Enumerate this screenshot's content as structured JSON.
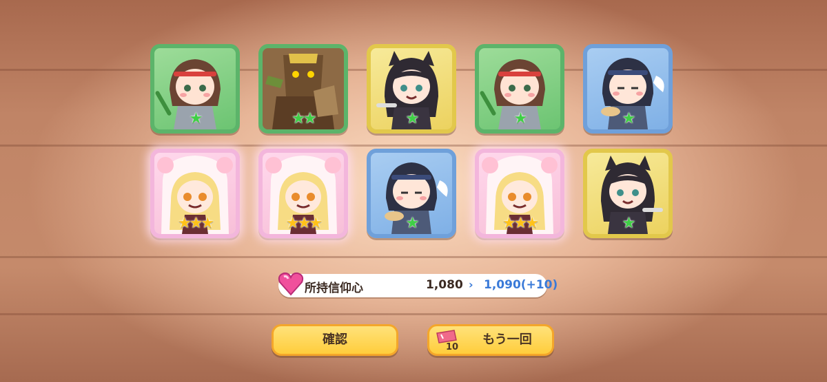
{
  "cards": [
    {
      "id": "c1",
      "frame": "green",
      "stars": 1,
      "star_color": "green",
      "character": "headband-girl"
    },
    {
      "id": "c2",
      "frame": "green",
      "stars": 2,
      "star_color": "green",
      "character": "wood-golem"
    },
    {
      "id": "c3",
      "frame": "yellow",
      "stars": 1,
      "star_color": "green",
      "character": "wolf-girl"
    },
    {
      "id": "c4",
      "frame": "green",
      "stars": 1,
      "star_color": "green",
      "character": "headband-girl"
    },
    {
      "id": "c5",
      "frame": "blue",
      "stars": 1,
      "star_color": "green",
      "character": "ninja-girl"
    },
    {
      "id": "c6",
      "frame": "rainbow",
      "stars": 3,
      "star_color": "gold",
      "character": "bear-hood-girl"
    },
    {
      "id": "c7",
      "frame": "rainbow",
      "stars": 3,
      "star_color": "gold",
      "character": "bear-hood-girl"
    },
    {
      "id": "c8",
      "frame": "blue",
      "stars": 1,
      "star_color": "green",
      "character": "ninja-girl"
    },
    {
      "id": "c9",
      "frame": "rainbow",
      "stars": 3,
      "star_color": "gold",
      "character": "bear-hood-girl"
    },
    {
      "id": "c10",
      "frame": "yellow",
      "stars": 1,
      "star_color": "green",
      "character": "wolf-girl"
    }
  ],
  "faith": {
    "label": "所持信仰心",
    "old_value": "1,080",
    "arrow": "›",
    "new_value": "1,090(+10)"
  },
  "buttons": {
    "confirm_label": "確認",
    "again_label": "もう一回",
    "ticket_count": "10"
  },
  "icons": {
    "heart": "heart-gem-icon",
    "ticket": "ticket-icon",
    "star": "star-icon"
  },
  "colors": {
    "button_fill": "#ffcd3c",
    "button_border": "#f4a62a",
    "value_blue": "#3a7ad8",
    "frame_green": "#5cb46a",
    "frame_yellow": "#e2c84b",
    "frame_blue": "#6fa0da"
  }
}
